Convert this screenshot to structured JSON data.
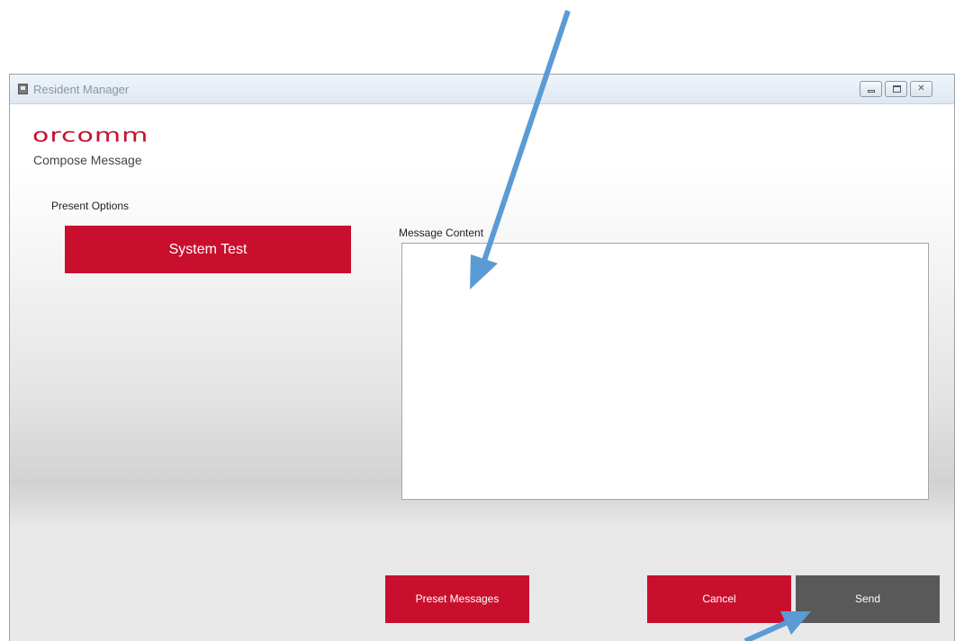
{
  "window": {
    "title": "Resident Manager",
    "controls": {
      "minimize": "",
      "maximize": "",
      "close": "✕"
    }
  },
  "header": {
    "logo_text": "orcomm",
    "subtitle": "Compose Message"
  },
  "present_options": {
    "label": "Present Options",
    "items": [
      {
        "label": "System Test"
      }
    ]
  },
  "message": {
    "label": "Message Content",
    "value": "",
    "placeholder": ""
  },
  "actions": {
    "preset_label": "Preset Messages",
    "cancel_label": "Cancel",
    "send_label": "Send"
  },
  "colors": {
    "brand_red": "#c8102e",
    "send_gray": "#595959",
    "annotation_arrow": "#5b9bd5"
  },
  "annotations": {
    "arrows": [
      {
        "points_to": "message-content-textarea"
      },
      {
        "points_to": "send-button"
      }
    ]
  }
}
